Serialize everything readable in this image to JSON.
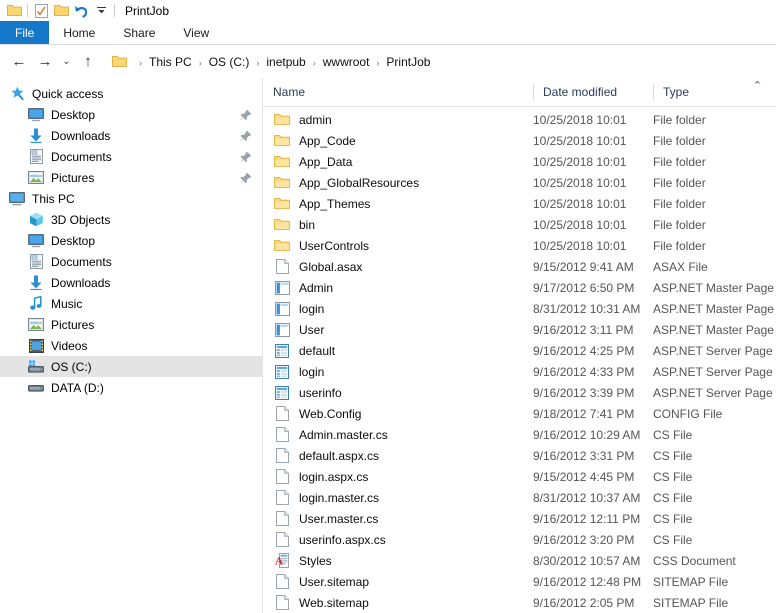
{
  "window": {
    "title": "PrintJob",
    "quick_access": [
      {
        "name": "folder-icon",
        "label": "Folder"
      },
      {
        "name": "properties-icon",
        "label": "Properties"
      },
      {
        "name": "new-folder-icon",
        "label": "New folder"
      },
      {
        "name": "undo-icon",
        "label": "Undo"
      },
      {
        "name": "customize-dropdown-icon",
        "label": "Customize Quick Access Toolbar"
      }
    ]
  },
  "ribbon": {
    "tabs": [
      {
        "label": "File",
        "active": true
      },
      {
        "label": "Home",
        "active": false
      },
      {
        "label": "Share",
        "active": false
      },
      {
        "label": "View",
        "active": false
      }
    ],
    "file_tab_color": "#1577c7"
  },
  "address": {
    "back_icon": "←",
    "forward_icon": "→",
    "recent_icon": "⌄",
    "up_icon": "↑",
    "crumbs": [
      "This PC",
      "OS (C:)",
      "inetpub",
      "wwwroot",
      "PrintJob"
    ],
    "separator": "›"
  },
  "sidebar": {
    "items": [
      {
        "label": "Quick access",
        "icon": "star-icon",
        "level": 0,
        "pinned": false,
        "selected": false
      },
      {
        "label": "Desktop",
        "icon": "desktop-icon",
        "level": 1,
        "pinned": true,
        "selected": false
      },
      {
        "label": "Downloads",
        "icon": "downloads-icon",
        "level": 1,
        "pinned": true,
        "selected": false
      },
      {
        "label": "Documents",
        "icon": "documents-icon",
        "level": 1,
        "pinned": true,
        "selected": false
      },
      {
        "label": "Pictures",
        "icon": "pictures-icon",
        "level": 1,
        "pinned": true,
        "selected": false
      },
      {
        "label": "This PC",
        "icon": "this-pc-icon",
        "level": 0,
        "pinned": false,
        "selected": false
      },
      {
        "label": "3D Objects",
        "icon": "3d-objects-icon",
        "level": 1,
        "pinned": false,
        "selected": false
      },
      {
        "label": "Desktop",
        "icon": "desktop-icon",
        "level": 1,
        "pinned": false,
        "selected": false
      },
      {
        "label": "Documents",
        "icon": "documents-icon",
        "level": 1,
        "pinned": false,
        "selected": false
      },
      {
        "label": "Downloads",
        "icon": "downloads-icon",
        "level": 1,
        "pinned": false,
        "selected": false
      },
      {
        "label": "Music",
        "icon": "music-icon",
        "level": 1,
        "pinned": false,
        "selected": false
      },
      {
        "label": "Pictures",
        "icon": "pictures-icon",
        "level": 1,
        "pinned": false,
        "selected": false
      },
      {
        "label": "Videos",
        "icon": "videos-icon",
        "level": 1,
        "pinned": false,
        "selected": false
      },
      {
        "label": "OS (C:)",
        "icon": "drive-icon",
        "level": 1,
        "pinned": false,
        "selected": true
      },
      {
        "label": "DATA (D:)",
        "icon": "drive-plain-icon",
        "level": 1,
        "pinned": false,
        "selected": false
      }
    ]
  },
  "filelist": {
    "columns": [
      {
        "label": "Name",
        "key": "name"
      },
      {
        "label": "Date modified",
        "key": "date"
      },
      {
        "label": "Type",
        "key": "type"
      }
    ],
    "sort_caret": "⌃",
    "rows": [
      {
        "name": "admin",
        "date": "10/25/2018 10:01",
        "type": "File folder",
        "icon": "folder-icon"
      },
      {
        "name": "App_Code",
        "date": "10/25/2018 10:01",
        "type": "File folder",
        "icon": "folder-icon"
      },
      {
        "name": "App_Data",
        "date": "10/25/2018 10:01",
        "type": "File folder",
        "icon": "folder-icon"
      },
      {
        "name": "App_GlobalResources",
        "date": "10/25/2018 10:01",
        "type": "File folder",
        "icon": "folder-icon"
      },
      {
        "name": "App_Themes",
        "date": "10/25/2018 10:01",
        "type": "File folder",
        "icon": "folder-icon"
      },
      {
        "name": "bin",
        "date": "10/25/2018 10:01",
        "type": "File folder",
        "icon": "folder-icon"
      },
      {
        "name": "UserControls",
        "date": "10/25/2018 10:01",
        "type": "File folder",
        "icon": "folder-icon"
      },
      {
        "name": "Global.asax",
        "date": "9/15/2012 9:41 AM",
        "type": "ASAX File",
        "icon": "generic-file-icon"
      },
      {
        "name": "Admin",
        "date": "9/17/2012 6:50 PM",
        "type": "ASP.NET Master Page",
        "icon": "master-page-icon"
      },
      {
        "name": "login",
        "date": "8/31/2012 10:31 AM",
        "type": "ASP.NET Master Page",
        "icon": "master-page-icon"
      },
      {
        "name": "User",
        "date": "9/16/2012 3:11 PM",
        "type": "ASP.NET Master Page",
        "icon": "master-page-icon"
      },
      {
        "name": "default",
        "date": "9/16/2012 4:25 PM",
        "type": "ASP.NET Server Page",
        "icon": "server-page-icon"
      },
      {
        "name": "login",
        "date": "9/16/2012 4:33 PM",
        "type": "ASP.NET Server Page",
        "icon": "server-page-icon"
      },
      {
        "name": "userinfo",
        "date": "9/16/2012 3:39 PM",
        "type": "ASP.NET Server Page",
        "icon": "server-page-icon"
      },
      {
        "name": "Web.Config",
        "date": "9/18/2012 7:41 PM",
        "type": "CONFIG File",
        "icon": "generic-file-icon"
      },
      {
        "name": "Admin.master.cs",
        "date": "9/16/2012 10:29 AM",
        "type": "CS File",
        "icon": "generic-file-icon"
      },
      {
        "name": "default.aspx.cs",
        "date": "9/16/2012 3:31 PM",
        "type": "CS File",
        "icon": "generic-file-icon"
      },
      {
        "name": "login.aspx.cs",
        "date": "9/15/2012 4:45 PM",
        "type": "CS File",
        "icon": "generic-file-icon"
      },
      {
        "name": "login.master.cs",
        "date": "8/31/2012 10:37 AM",
        "type": "CS File",
        "icon": "generic-file-icon"
      },
      {
        "name": "User.master.cs",
        "date": "9/16/2012 12:11 PM",
        "type": "CS File",
        "icon": "generic-file-icon"
      },
      {
        "name": "userinfo.aspx.cs",
        "date": "9/16/2012 3:20 PM",
        "type": "CS File",
        "icon": "generic-file-icon"
      },
      {
        "name": "Styles",
        "date": "8/30/2012 10:57 AM",
        "type": "CSS Document",
        "icon": "css-document-icon"
      },
      {
        "name": "User.sitemap",
        "date": "9/16/2012 12:48 PM",
        "type": "SITEMAP File",
        "icon": "generic-file-icon"
      },
      {
        "name": "Web.sitemap",
        "date": "9/16/2012 2:05 PM",
        "type": "SITEMAP File",
        "icon": "generic-file-icon"
      }
    ]
  }
}
